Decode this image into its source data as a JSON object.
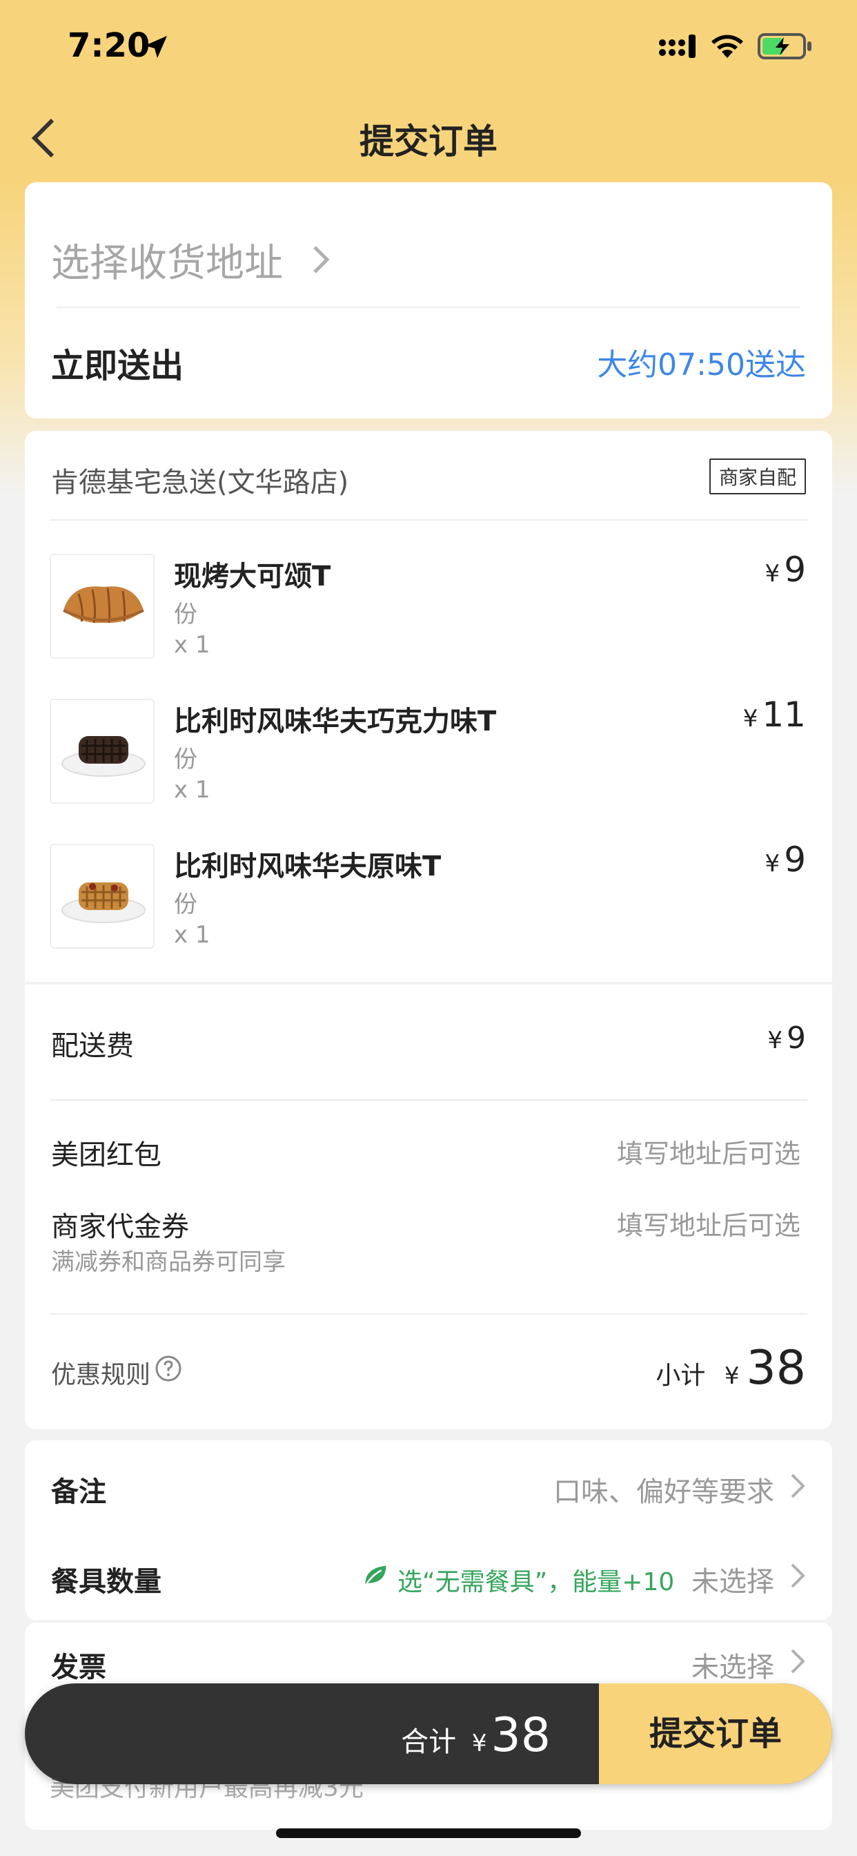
{
  "status_bar": {
    "time": "7:20"
  },
  "header": {
    "title": "提交订单"
  },
  "address": {
    "placeholder": "选择收货地址",
    "delivery_mode": "立即送出",
    "eta": "大约07:50送达"
  },
  "store": {
    "name": "肯德基宅急送(文华路店)",
    "delivery_tag": "商家自配",
    "currency": "¥",
    "items": [
      {
        "name": "现烤大可颂T",
        "unit": "份",
        "qty": "x 1",
        "price": "9",
        "icon": "croissant-image"
      },
      {
        "name": "比利时风味华夫巧克力味T",
        "unit": "份",
        "qty": "x 1",
        "price": "11",
        "icon": "chocolate-waffle-image"
      },
      {
        "name": "比利时风味华夫原味T",
        "unit": "份",
        "qty": "x 1",
        "price": "9",
        "icon": "original-waffle-image"
      }
    ]
  },
  "fees": {
    "delivery_fee_label": "配送费",
    "delivery_fee": "9",
    "red_packet_label": "美团红包",
    "red_packet_value": "填写地址后可选",
    "voucher_label": "商家代金券",
    "voucher_sub": "满减券和商品券可同享",
    "voucher_value": "填写地址后可选",
    "rules_label": "优惠规则",
    "subtotal_label": "小计",
    "subtotal": "38"
  },
  "options": {
    "remark_label": "备注",
    "remark_placeholder": "口味、偏好等要求",
    "tableware_label": "餐具数量",
    "tableware_promo": "选“无需餐具”，能量+10",
    "tableware_value": "未选择",
    "invoice_label": "发票",
    "invoice_value": "未选择"
  },
  "payment": {
    "hint": "美团支付新用户最高再减3元"
  },
  "checkout": {
    "total_label": "合计",
    "total": "38",
    "submit": "提交订单"
  },
  "colors": {
    "header_yellow": "#f7d47b",
    "link_blue": "#3c86e8",
    "promo_green": "#36a55c",
    "bar_dark": "#333333"
  }
}
